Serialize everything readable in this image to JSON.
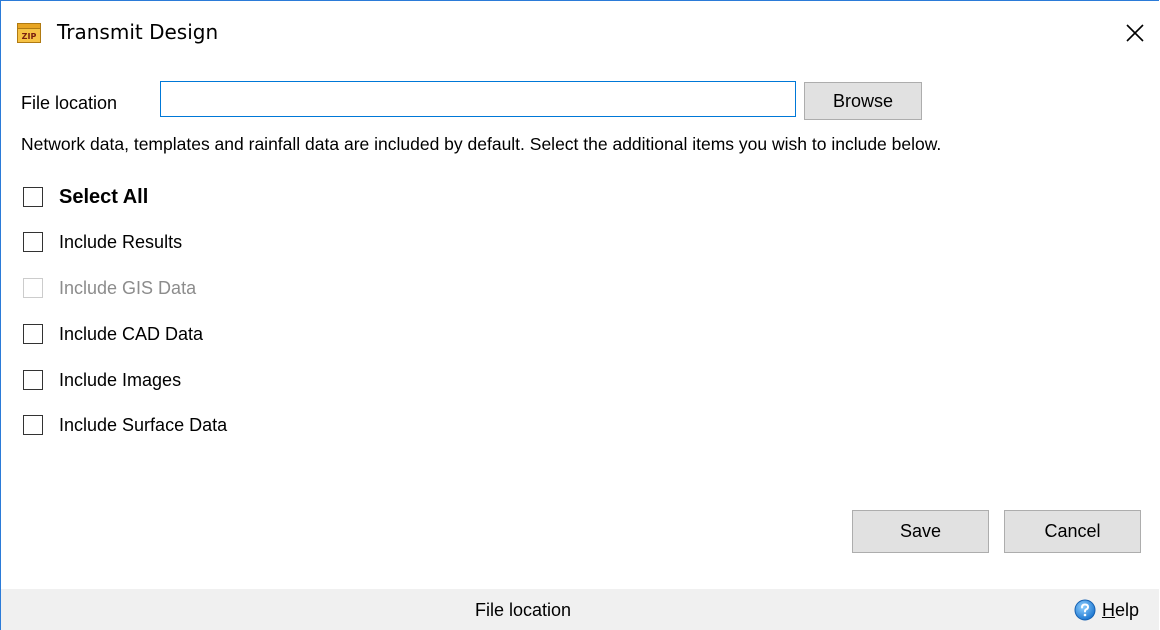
{
  "window": {
    "title": "Transmit Design",
    "app_icon_text": "ZIP"
  },
  "form": {
    "file_location_label": "File location",
    "file_location_value": "",
    "browse_label": "Browse",
    "info_text": "Network data, templates and rainfall data are included by default. Select the additional items you wish to include below."
  },
  "options": {
    "select_all": {
      "label": "Select All",
      "checked": false,
      "enabled": true
    },
    "include_results": {
      "label": "Include Results",
      "checked": false,
      "enabled": true
    },
    "include_gis": {
      "label": "Include GIS Data",
      "checked": false,
      "enabled": false
    },
    "include_cad": {
      "label": "Include CAD Data",
      "checked": false,
      "enabled": true
    },
    "include_images": {
      "label": "Include Images",
      "checked": false,
      "enabled": true
    },
    "include_surface": {
      "label": "Include Surface Data",
      "checked": false,
      "enabled": true
    }
  },
  "actions": {
    "save_label": "Save",
    "cancel_label": "Cancel"
  },
  "statusbar": {
    "text": "File location",
    "help_first": "H",
    "help_rest": "elp"
  },
  "colors": {
    "accent": "#0078d7",
    "window_border": "#2b7bd8",
    "button_bg": "#e1e1e1",
    "statusbar_bg": "#f0f0f0",
    "disabled_text": "#8c8c8c"
  },
  "icons": {
    "app": "zip-archive-icon",
    "close": "close-icon",
    "help": "help-circle-icon"
  }
}
